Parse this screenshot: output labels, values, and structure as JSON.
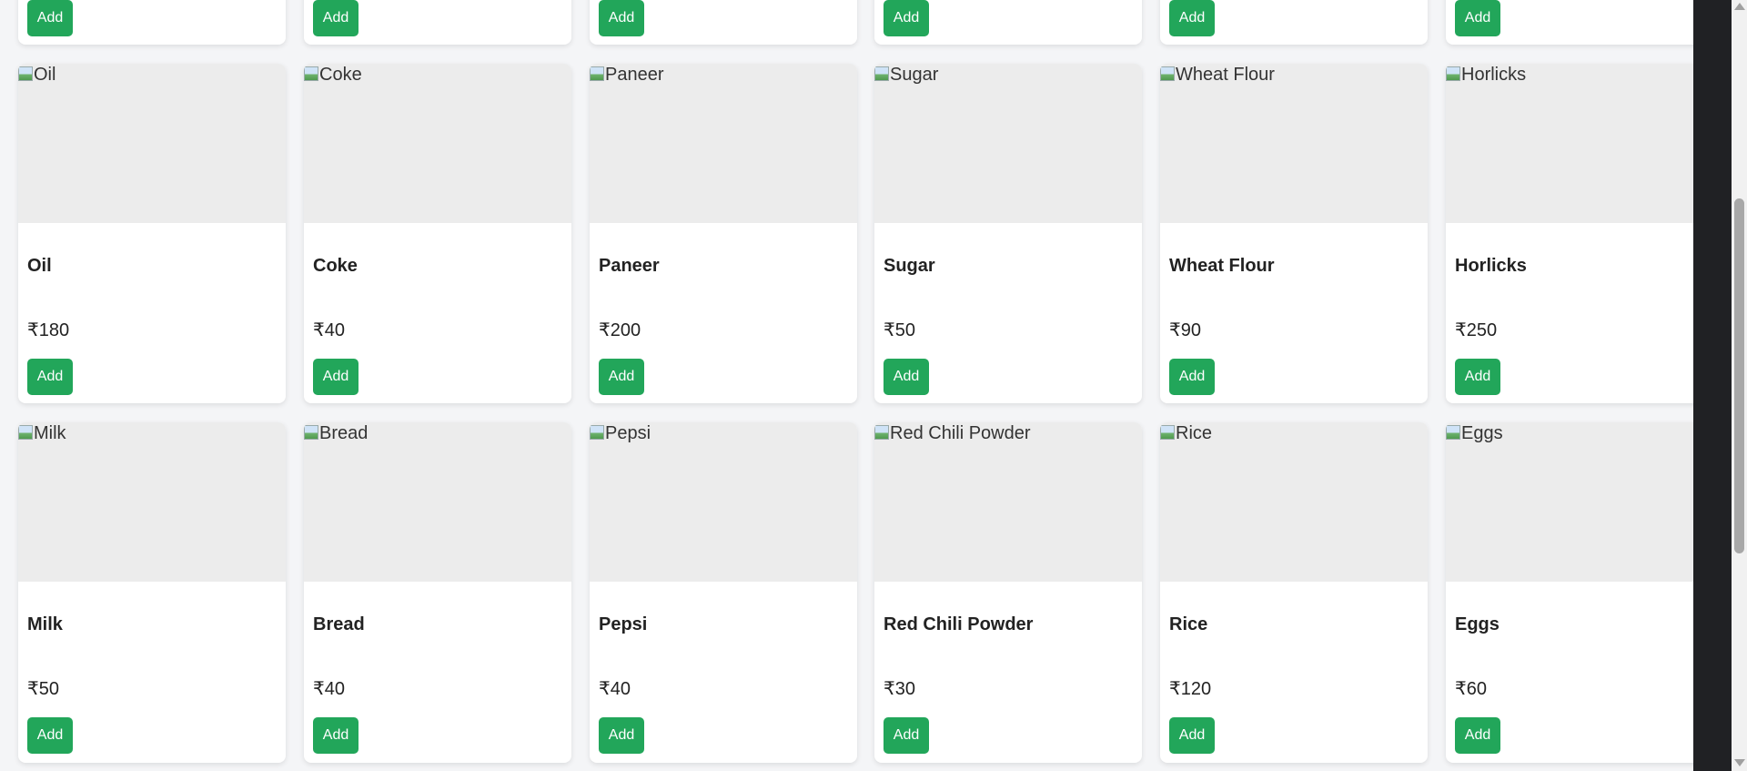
{
  "top_row": {
    "add_label": "Add"
  },
  "products_row1": [
    {
      "name": "Oil",
      "alt": "Oil",
      "price": "₹180",
      "add": "Add"
    },
    {
      "name": "Coke",
      "alt": "Coke",
      "price": "₹40",
      "add": "Add"
    },
    {
      "name": "Paneer",
      "alt": "Paneer",
      "price": "₹200",
      "add": "Add"
    },
    {
      "name": "Sugar",
      "alt": "Sugar",
      "price": "₹50",
      "add": "Add"
    },
    {
      "name": "Wheat Flour",
      "alt": "Wheat Flour",
      "price": "₹90",
      "add": "Add"
    },
    {
      "name": "Horlicks",
      "alt": "Horlicks",
      "price": "₹250",
      "add": "Add"
    }
  ],
  "products_row2": [
    {
      "name": "Milk",
      "alt": "Milk",
      "price": "₹50",
      "add": "Add"
    },
    {
      "name": "Bread",
      "alt": "Bread",
      "price": "₹40",
      "add": "Add"
    },
    {
      "name": "Pepsi",
      "alt": "Pepsi",
      "price": "₹40",
      "add": "Add"
    },
    {
      "name": "Red Chili Powder",
      "alt": "Red Chili Powder",
      "price": "₹30",
      "add": "Add"
    },
    {
      "name": "Rice",
      "alt": "Rice",
      "price": "₹120",
      "add": "Add"
    },
    {
      "name": "Eggs",
      "alt": "Eggs",
      "price": "₹60",
      "add": "Add"
    }
  ],
  "colors": {
    "accent": "#22a65a",
    "page_bg": "#f4f5f7",
    "image_bg": "#ececec"
  },
  "icons": {
    "broken_image": "broken-image-icon"
  }
}
